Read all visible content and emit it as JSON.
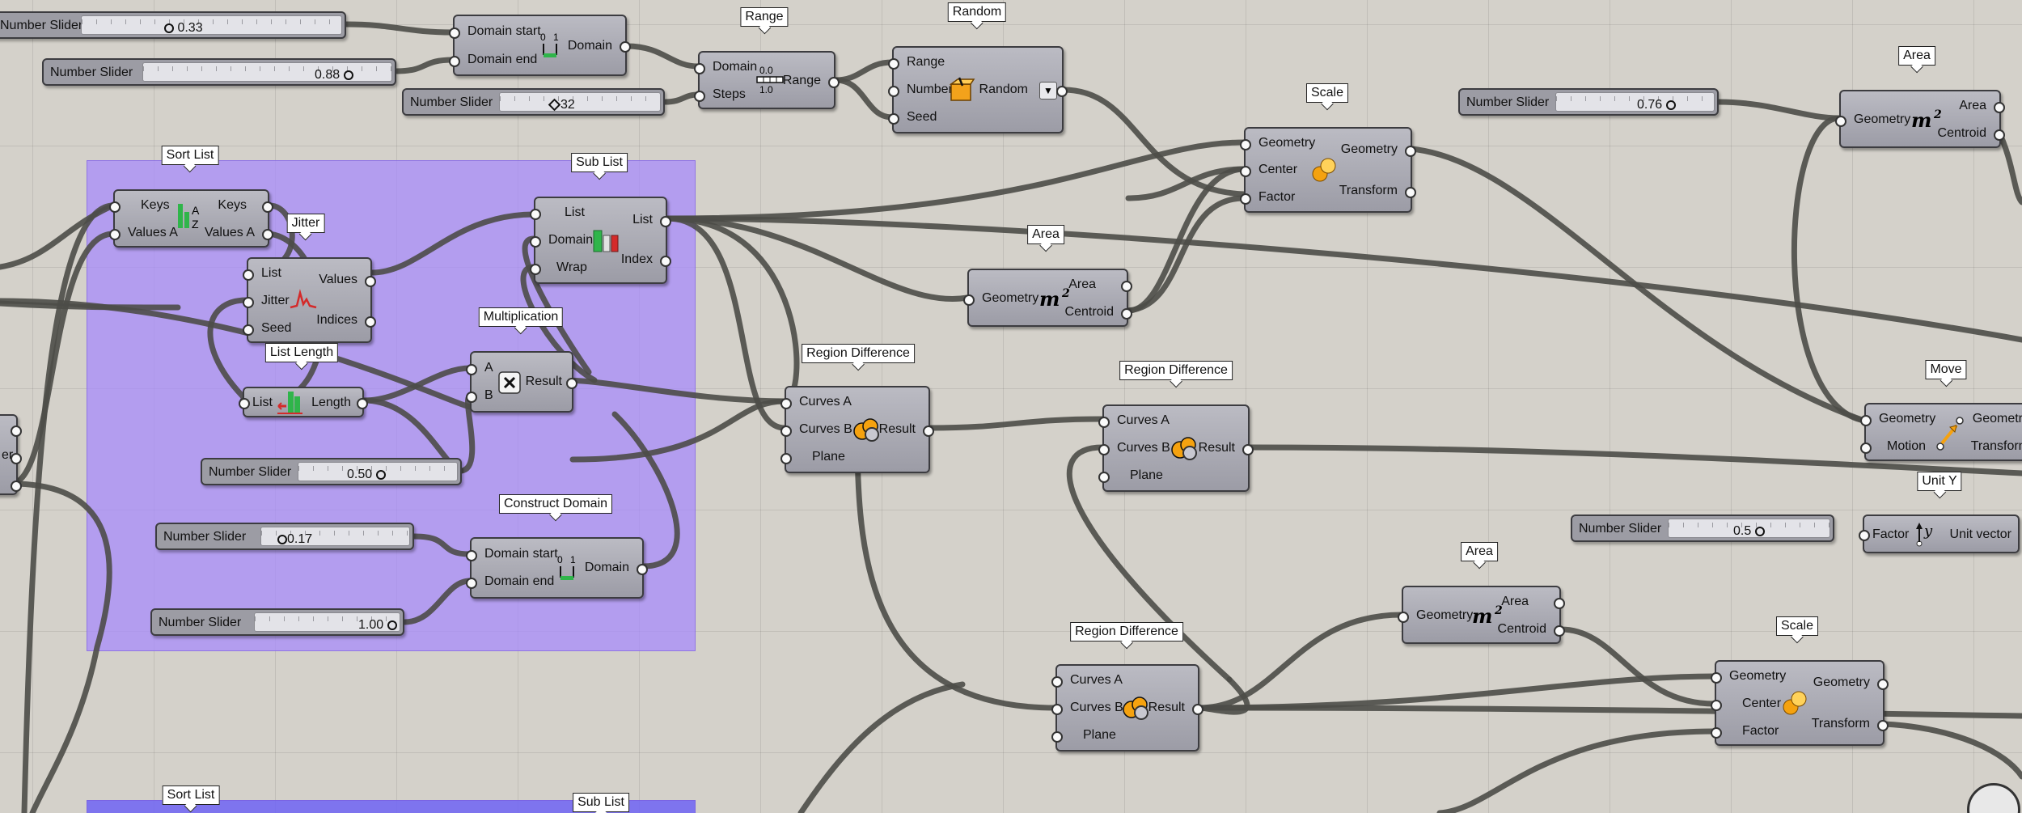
{
  "sliders": {
    "s1": {
      "label": "Number Slider",
      "value": "0.33"
    },
    "s2": {
      "label": "Number Slider",
      "value": "0.88"
    },
    "s3": {
      "label": "Number Slider",
      "value": "32"
    },
    "s4": {
      "label": "Number Slider",
      "value": "0.76"
    },
    "s5": {
      "label": "Number Slider",
      "value": "0.50"
    },
    "s6": {
      "label": "Number Slider",
      "value": "0.17"
    },
    "s7": {
      "label": "Number Slider",
      "value": "1.00"
    },
    "s8": {
      "label": "Number Slider",
      "value": "0.5"
    }
  },
  "components": {
    "construct_domain_top": {
      "in1": "Domain start",
      "in2": "Domain end",
      "out1": "Domain"
    },
    "range": {
      "tag": "Range",
      "in1": "Domain",
      "in2": "Steps",
      "out1": "Range"
    },
    "random": {
      "tag": "Random",
      "in1": "Range",
      "in2": "Number",
      "in3": "Seed",
      "out1": "Random"
    },
    "scale_top": {
      "tag": "Scale",
      "in1": "Geometry",
      "in2": "Center",
      "in3": "Factor",
      "out1": "Geometry",
      "out2": "Transform"
    },
    "area_top_right": {
      "tag": "Area",
      "in1": "Geometry",
      "out1": "Area",
      "out2": "Centroid"
    },
    "sort_list": {
      "tag": "Sort List",
      "in1": "Keys",
      "in2": "Values A",
      "out1": "Keys",
      "out2": "Values A"
    },
    "sub_list": {
      "tag": "Sub List",
      "in1": "List",
      "in2": "Domain",
      "in3": "Wrap",
      "out1": "List",
      "out2": "Index"
    },
    "jitter": {
      "tag": "Jitter",
      "in1": "List",
      "in2": "Jitter",
      "in3": "Seed",
      "out1": "Values",
      "out2": "Indices"
    },
    "area_mid": {
      "tag": "Area",
      "in1": "Geometry",
      "out1": "Area",
      "out2": "Centroid"
    },
    "list_length": {
      "tag": "List Length",
      "in1": "List",
      "out1": "Length"
    },
    "multiplication": {
      "tag": "Multiplication",
      "in1": "A",
      "in2": "B",
      "out1": "Result"
    },
    "region_diff_1": {
      "tag": "Region Difference",
      "in1": "Curves A",
      "in2": "Curves B",
      "in3": "Plane",
      "out1": "Result"
    },
    "region_diff_2": {
      "tag": "Region Difference",
      "in1": "Curves A",
      "in2": "Curves B",
      "in3": "Plane",
      "out1": "Result"
    },
    "region_diff_3": {
      "tag": "Region Difference",
      "in1": "Curves A",
      "in2": "Curves B",
      "in3": "Plane",
      "out1": "Result"
    },
    "move": {
      "tag": "Move",
      "in1": "Geometry",
      "in2": "Motion",
      "out1": "Geometry",
      "out2": "Transform"
    },
    "unit_y": {
      "tag": "Unit Y",
      "in1": "Factor",
      "out1": "Unit vector"
    },
    "construct_domain_group": {
      "tag": "Construct Domain",
      "in1": "Domain start",
      "in2": "Domain end",
      "out1": "Domain"
    },
    "area_bottom": {
      "tag": "Area",
      "in1": "Geometry",
      "out1": "Area",
      "out2": "Centroid"
    },
    "scale_bottom": {
      "tag": "Scale",
      "in1": "Geometry",
      "in2": "Center",
      "in3": "Factor",
      "out1": "Geometry",
      "out2": "Transform"
    }
  },
  "bottom_tags": {
    "sort_list": "Sort List",
    "sub_list": "Sub List"
  },
  "cutoff": {
    "left_er": "er"
  },
  "icons": {
    "domain": "domain-icon",
    "range": "range-icon",
    "random": "random-dice-icon",
    "scale": "scale-spheres-icon",
    "area": "area-m2-icon",
    "sort": "sort-az-icon",
    "sublist": "sublist-icon",
    "jitter": "jitter-wave-icon",
    "length": "list-length-icon",
    "multiply": "multiply-icon",
    "region": "region-difference-icon",
    "move": "move-arrow-icon",
    "unity": "unit-y-icon"
  },
  "colors": {
    "canvas": "#d4d1ca",
    "group": "#a587ff",
    "component": "#a8a8b0",
    "wire": "#4d4c48"
  }
}
